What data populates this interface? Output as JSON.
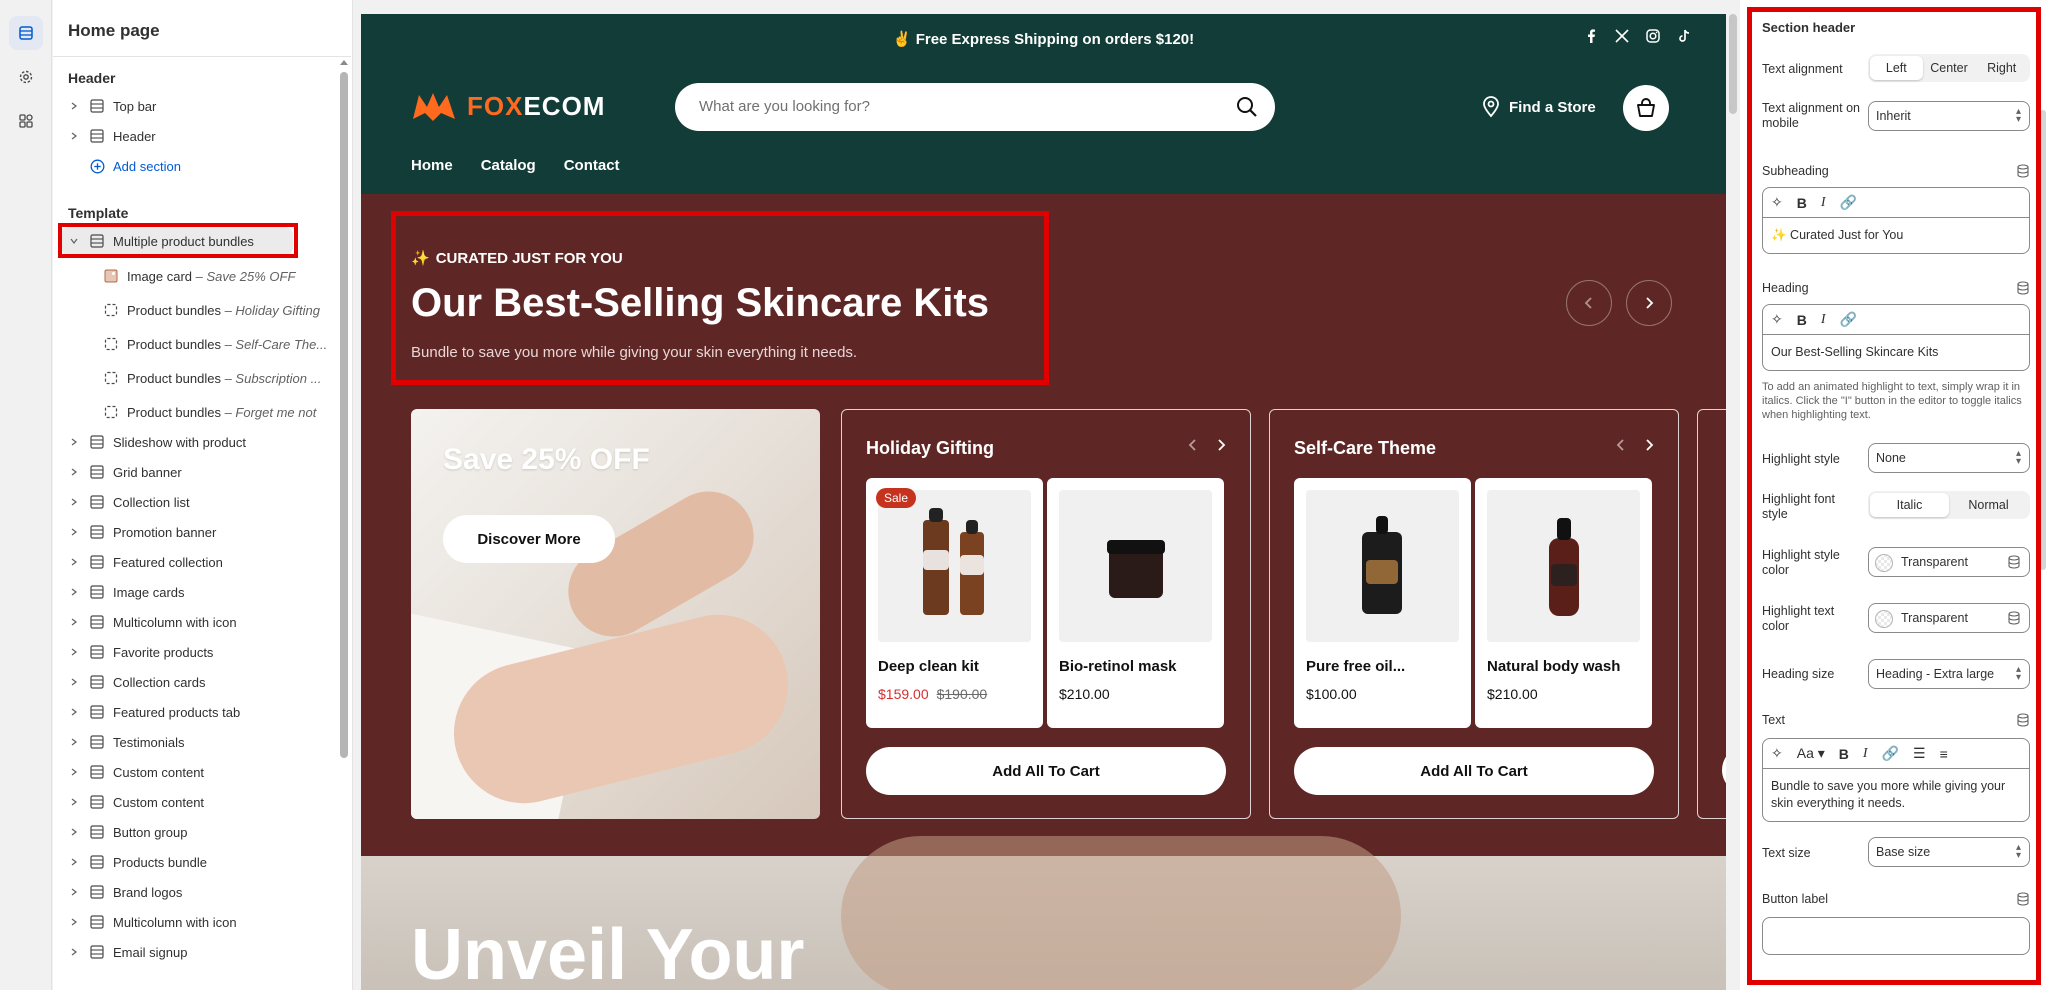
{
  "sidebar": {
    "title": "Home page",
    "header_group": "Header",
    "header_items": [
      "Top bar",
      "Header"
    ],
    "add_section": "Add section",
    "template_group": "Template",
    "selected_item": "Multiple product bundles",
    "children": [
      {
        "label": "Image card",
        "sub": "Save 25% OFF"
      },
      {
        "label": "Product bundles",
        "sub": "Holiday Gifting"
      },
      {
        "label": "Product bundles",
        "sub": "Self-Care The..."
      },
      {
        "label": "Product bundles",
        "sub": "Subscription ..."
      },
      {
        "label": "Product bundles",
        "sub": "Forget me not"
      }
    ],
    "sections": [
      "Slideshow with product",
      "Grid banner",
      "Collection list",
      "Promotion banner",
      "Featured collection",
      "Image cards",
      "Multicolumn with icon",
      "Favorite products",
      "Collection cards",
      "Featured products tab",
      "Testimonials",
      "Custom content",
      "Custom content",
      "Button group",
      "Products bundle",
      "Brand logos",
      "Multicolumn with icon",
      "Email signup"
    ],
    "separator": " – "
  },
  "store": {
    "announcement": "✌ Free Express Shipping on orders $120!",
    "logo_prefix": "FOX",
    "logo_suffix": "ECOM",
    "search_placeholder": "What are you looking for?",
    "find_store": "Find a Store",
    "nav": [
      "Home",
      "Catalog",
      "Contact"
    ],
    "eyebrow": "CURATED JUST FOR YOU",
    "heading": "Our Best-Selling Skincare Kits",
    "subtext": "Bundle to save you more while giving your skin everything it needs.",
    "image_card": {
      "title": "Save 25% OFF",
      "button": "Discover More"
    },
    "bundles": [
      {
        "title": "Holiday Gifting",
        "add_all": "Add All To Cart",
        "products": [
          {
            "name": "Deep clean kit",
            "price": "$159.00",
            "compare": "$190.00",
            "badge": "Sale"
          },
          {
            "name": "Bio-retinol mask",
            "price": "$210.00"
          }
        ]
      },
      {
        "title": "Self-Care Theme",
        "add_all": "Add All To Cart",
        "products": [
          {
            "name": "Pure free oil...",
            "price": "$100.00"
          },
          {
            "name": "Natural body wash",
            "price": "$210.00"
          }
        ]
      }
    ],
    "next_heading": "Unveil Your"
  },
  "panel": {
    "title": "Section header",
    "text_alignment_label": "Text alignment",
    "text_alignment_options": [
      "Left",
      "Center",
      "Right"
    ],
    "text_alignment_mobile_label": "Text alignment on mobile",
    "text_alignment_mobile_value": "Inherit",
    "subheading_label": "Subheading",
    "subheading_value": "✨ Curated Just for You",
    "heading_label": "Heading",
    "heading_value": "Our Best-Selling Skincare Kits",
    "heading_help": "To add an animated highlight to text, simply wrap it in italics. Click the \"I\" button in the editor to toggle italics when highlighting text.",
    "highlight_style_label": "Highlight style",
    "highlight_style_value": "None",
    "highlight_font_style_label": "Highlight font style",
    "highlight_font_style_options": [
      "Italic",
      "Normal"
    ],
    "highlight_style_color_label": "Highlight style color",
    "highlight_style_color_value": "Transparent",
    "highlight_text_color_label": "Highlight text color",
    "highlight_text_color_value": "Transparent",
    "heading_size_label": "Heading size",
    "heading_size_value": "Heading - Extra large",
    "text_label": "Text",
    "text_value": "Bundle to save you more while giving your skin everything it needs.",
    "text_size_label": "Text size",
    "text_size_value": "Base size",
    "button_label_label": "Button label",
    "button_label_value": ""
  },
  "colors": {
    "header_bg": "#123c37",
    "section_bg": "#5e2725",
    "highlight_border": "#e00000",
    "logo_accent": "#ff6a1f",
    "sale": "#c5321e"
  }
}
